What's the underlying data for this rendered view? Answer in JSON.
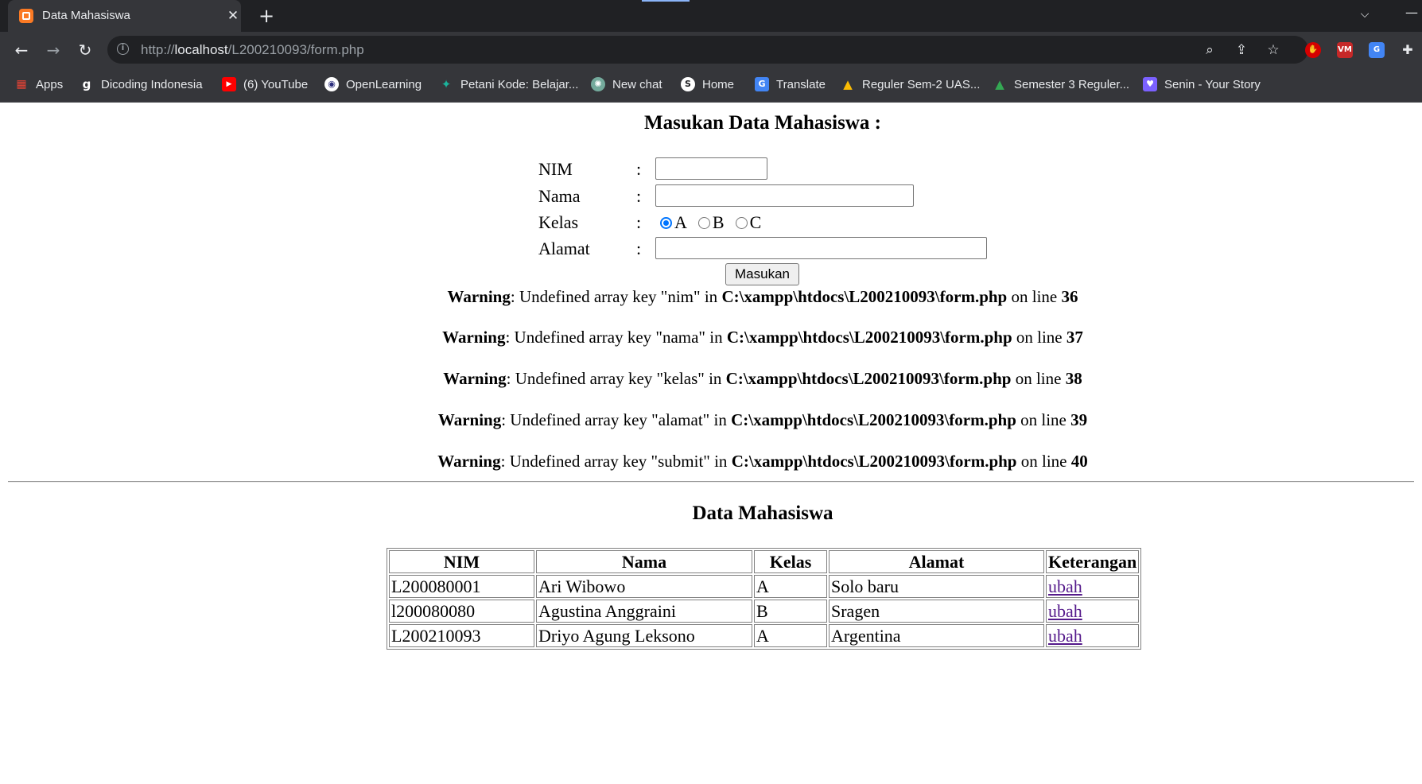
{
  "browser": {
    "tab": {
      "title": "Data Mahasiswa",
      "close": "✕"
    },
    "new_tab": "+",
    "url": {
      "scheme": "http://",
      "host": "localhost",
      "path": "/L200210093/form.php"
    },
    "bookmarks": [
      {
        "label": "Apps",
        "icon": "apps-grid-icon",
        "color": "#ea4335"
      },
      {
        "label": "Dicoding Indonesia",
        "icon": "dicoding-icon",
        "color": "#ffffff"
      },
      {
        "label": "(6) YouTube",
        "icon": "youtube-icon",
        "color": "#ff0000"
      },
      {
        "label": "OpenLearning",
        "icon": "openlearning-icon",
        "color": "#2b2d7c"
      },
      {
        "label": "Petani Kode: Belajar...",
        "icon": "petanikode-icon",
        "color": "#1bb39b"
      },
      {
        "label": "New chat",
        "icon": "chatgpt-icon",
        "color": "#74aa9c"
      },
      {
        "label": "Home",
        "icon": "home-s-icon",
        "color": "#ffffff"
      },
      {
        "label": "Translate",
        "icon": "google-translate-icon",
        "color": "#4285f4"
      },
      {
        "label": "Reguler Sem-2 UAS...",
        "icon": "google-drive-icon",
        "color": "#34a853"
      },
      {
        "label": "Semester 3 Reguler...",
        "icon": "google-drive-icon",
        "color": "#34a853"
      },
      {
        "label": "Senin - Your Story",
        "icon": "heart-icon",
        "color": "#7b61ff"
      }
    ]
  },
  "form": {
    "heading": "Masukan Data Mahasiswa :",
    "colon": ":",
    "labels": {
      "nim": "NIM",
      "nama": "Nama",
      "kelas": "Kelas",
      "alamat": "Alamat"
    },
    "values": {
      "nim": "",
      "nama": "",
      "alamat": ""
    },
    "kelas_options": [
      "A",
      "B",
      "C"
    ],
    "kelas_selected": "A",
    "submit_label": "Masukan"
  },
  "warnings": [
    {
      "prefix": "Warning",
      "msg": ": Undefined array key \"nim\" in ",
      "file": "C:\\xampp\\htdocs\\L200210093\\form.php",
      "mid": " on line ",
      "line": "36"
    },
    {
      "prefix": "Warning",
      "msg": ": Undefined array key \"nama\" in ",
      "file": "C:\\xampp\\htdocs\\L200210093\\form.php",
      "mid": " on line ",
      "line": "37"
    },
    {
      "prefix": "Warning",
      "msg": ": Undefined array key \"kelas\" in ",
      "file": "C:\\xampp\\htdocs\\L200210093\\form.php",
      "mid": " on line ",
      "line": "38"
    },
    {
      "prefix": "Warning",
      "msg": ": Undefined array key \"alamat\" in ",
      "file": "C:\\xampp\\htdocs\\L200210093\\form.php",
      "mid": " on line ",
      "line": "39"
    },
    {
      "prefix": "Warning",
      "msg": ": Undefined array key \"submit\" in ",
      "file": "C:\\xampp\\htdocs\\L200210093\\form.php",
      "mid": " on line ",
      "line": "40"
    }
  ],
  "table": {
    "heading": "Data Mahasiswa",
    "columns": [
      "NIM",
      "Nama",
      "Kelas",
      "Alamat",
      "Keterangan"
    ],
    "rows": [
      [
        "L200080001",
        "Ari Wibowo",
        "A",
        "Solo baru",
        "ubah"
      ],
      [
        "l200080080",
        "Agustina Anggraini",
        "B",
        "Sragen",
        "ubah"
      ],
      [
        "L200210093",
        "Driyo Agung Leksono",
        "A",
        "Argentina",
        "ubah"
      ]
    ]
  }
}
